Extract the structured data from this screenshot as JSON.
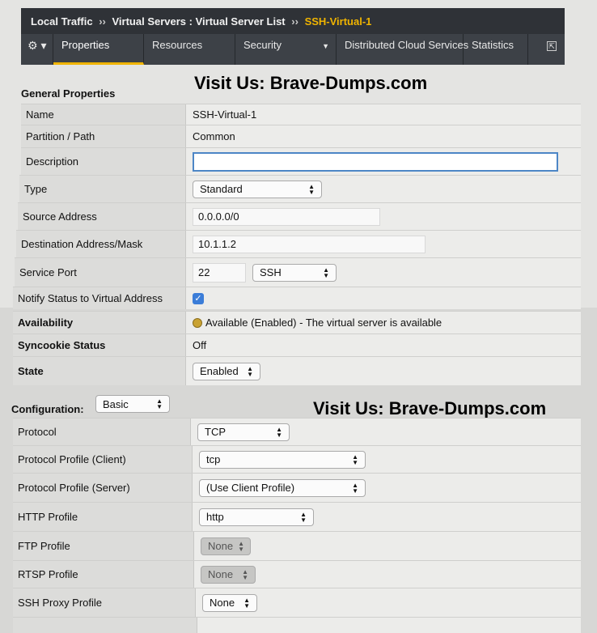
{
  "breadcrumb": {
    "part1": "Local Traffic",
    "sep": "››",
    "part2": "Virtual Servers : Virtual Server List",
    "current": "SSH-Virtual-1"
  },
  "tabs": {
    "gear": "⚙ ▾",
    "properties": "Properties",
    "resources": "Resources",
    "security": "Security",
    "distributed": "Distributed Cloud Services",
    "statistics": "Statistics"
  },
  "watermark": "Visit Us: Brave-Dumps.com",
  "general": {
    "title": "General Properties",
    "name_label": "Name",
    "name_value": "SSH-Virtual-1",
    "partition_label": "Partition / Path",
    "partition_value": "Common",
    "description_label": "Description",
    "description_value": "",
    "type_label": "Type",
    "type_value": "Standard",
    "source_label": "Source Address",
    "source_value": "0.0.0.0/0",
    "dest_label": "Destination Address/Mask",
    "dest_value": "10.1.1.2",
    "port_label": "Service Port",
    "port_value": "22",
    "port_service": "SSH",
    "notify_label": "Notify Status to Virtual Address",
    "availability_label": "Availability",
    "availability_value": "Available (Enabled) - The virtual server is available",
    "syncookie_label": "Syncookie Status",
    "syncookie_value": "Off",
    "state_label": "State",
    "state_value": "Enabled"
  },
  "configuration": {
    "title": "Configuration:",
    "mode": "Basic",
    "protocol_label": "Protocol",
    "protocol_value": "TCP",
    "client_label": "Protocol Profile (Client)",
    "client_value": "tcp",
    "server_label": "Protocol Profile (Server)",
    "server_value": "(Use Client Profile)",
    "http_label": "HTTP Profile",
    "http_value": "http",
    "ftp_label": "FTP Profile",
    "ftp_value": "None",
    "rtsp_label": "RTSP Profile",
    "rtsp_value": "None",
    "ssh_label": "SSH Proxy Profile",
    "ssh_value": "None"
  }
}
